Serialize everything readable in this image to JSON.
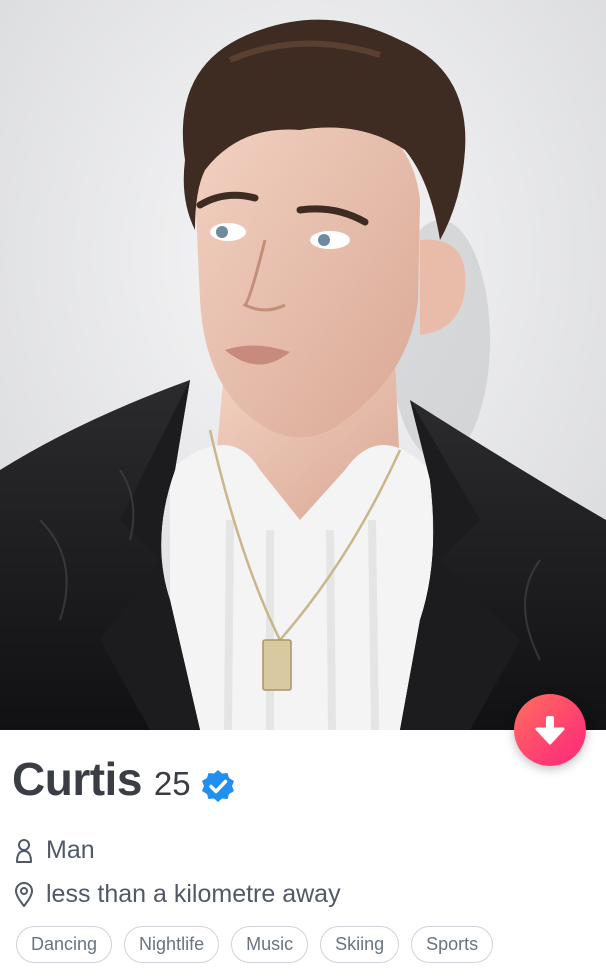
{
  "profile": {
    "name": "Curtis",
    "age": "25",
    "verified_icon": "verified-badge-icon",
    "gender": "Man",
    "gender_icon": "person-icon",
    "distance": "less than a kilometre away",
    "distance_icon": "location-pin-icon",
    "photo_subject": "photo"
  },
  "interests": [
    "Dancing",
    "Nightlife",
    "Music",
    "Skiing",
    "Sports"
  ],
  "controls": {
    "collapse_icon": "arrow-down-icon"
  },
  "colors": {
    "accent_gradient_start": "#ff6f5e",
    "accent_gradient_end": "#fd2b7b",
    "verified_blue": "#1f8ff0",
    "text_dark": "#3a3d44",
    "text_muted": "#505965"
  }
}
